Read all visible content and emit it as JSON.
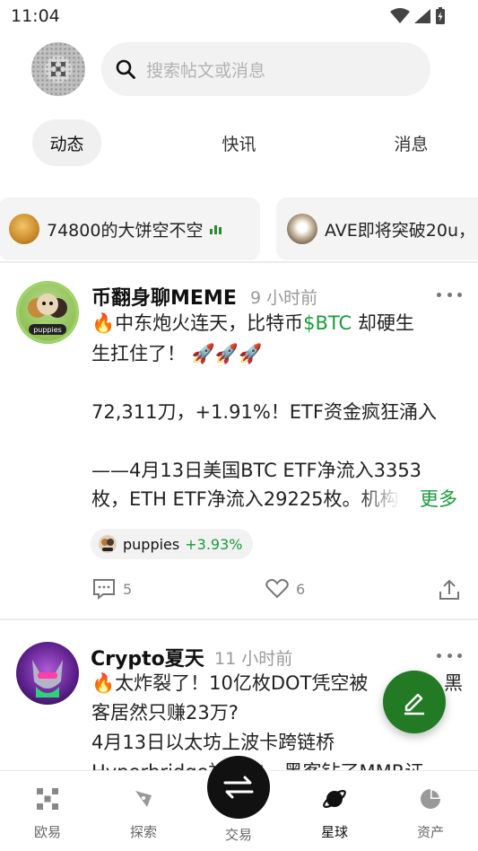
{
  "status_bar": {
    "time": "11:04"
  },
  "search": {
    "placeholder": "搜索帖文或消息"
  },
  "tabs": [
    {
      "label": "动态",
      "active": true
    },
    {
      "label": "快讯",
      "active": false
    },
    {
      "label": "消息",
      "active": false
    }
  ],
  "hot_topics": [
    {
      "text": "74800的大饼空不空"
    },
    {
      "text": "AVE即将突破20u，"
    }
  ],
  "posts": [
    {
      "author": "币翻身聊MEME",
      "time": "9 小时前",
      "line1_pre": "中东炮火连天，比特币",
      "line1_ticker": "$BTC",
      "line1_post": " 却硬生",
      "line2": "生扛住了！",
      "line3": "72,311刀，+1.91%！ETF资金疯狂涌入",
      "line4": "——4月13日美国BTC ETF净流入3353",
      "line5": "枚，ETH ETF净流入29225枚。机构",
      "more": "更多",
      "coin": {
        "name": "puppies",
        "change": "+3.93%"
      },
      "comments": "5",
      "likes": "6",
      "avatar_label": "puppies"
    },
    {
      "author": "Crypto夏天",
      "time": "11 小时前",
      "line1": "太炸裂了！10亿枚DOT凭空被",
      "line1_tail": "黑",
      "line2": "客居然只赚23万?",
      "line3": "4月13日以太坊上波卡跨链桥",
      "line4": "Hyperbridge被攻击，黑客钻了MMR证"
    }
  ],
  "bottom_nav": [
    {
      "label": "欧易",
      "icon": "okx-logo-icon"
    },
    {
      "label": "探索",
      "icon": "compass-icon"
    },
    {
      "label": "交易",
      "icon": "swap-icon"
    },
    {
      "label": "星球",
      "icon": "planet-icon",
      "active": true
    },
    {
      "label": "资产",
      "icon": "pie-chart-icon"
    }
  ],
  "colors": {
    "accent_green": "#1a9a3a",
    "fab": "#237a24"
  }
}
